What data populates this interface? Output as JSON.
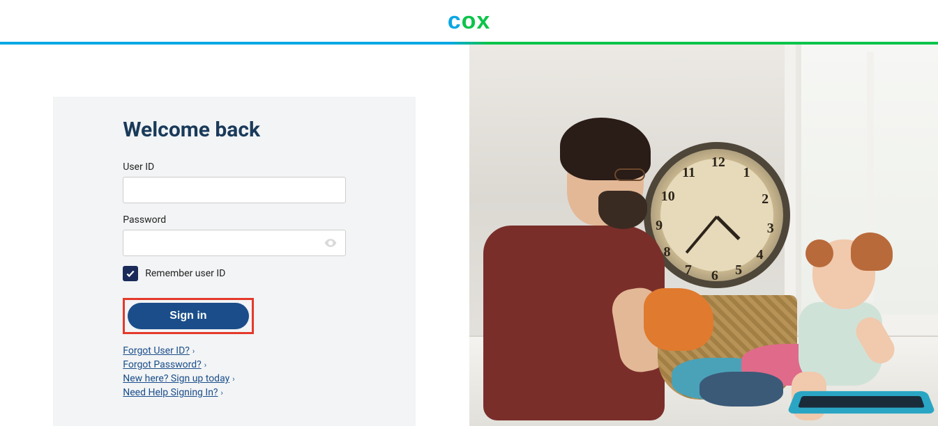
{
  "brand": "cox",
  "form": {
    "title": "Welcome back",
    "userid_label": "User ID",
    "password_label": "Password",
    "remember_label": "Remember user ID",
    "remember_checked": true,
    "signin_label": "Sign in"
  },
  "links": {
    "forgot_user": "Forgot User ID?",
    "forgot_password": "Forgot Password?",
    "signup": "New here? Sign up today",
    "help": "Need Help Signing In?"
  },
  "clock_numbers": [
    "12",
    "1",
    "2",
    "3",
    "4",
    "5",
    "6",
    "7",
    "8",
    "9",
    "10",
    "11"
  ],
  "highlight": {
    "color": "#e5392b"
  }
}
